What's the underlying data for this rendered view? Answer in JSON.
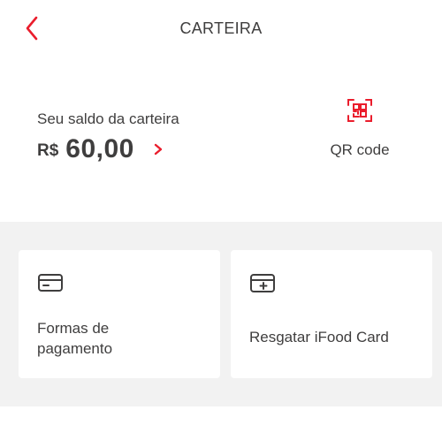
{
  "header": {
    "title": "CARTEIRA",
    "back_icon": "chevron-left-icon"
  },
  "wallet": {
    "balance_label": "Seu saldo da carteira",
    "currency": "R$",
    "amount": "60,00",
    "qr_label": "QR code"
  },
  "actions": [
    {
      "line1": "Formas de",
      "line2": "pagamento",
      "icon": "credit-card-icon"
    },
    {
      "label": "Resgatar iFood Card",
      "icon": "gift-card-add-icon"
    }
  ],
  "colors": {
    "accent": "#ea1d2c",
    "text": "#3f3e3e",
    "background_grey": "#f2f2f2"
  }
}
